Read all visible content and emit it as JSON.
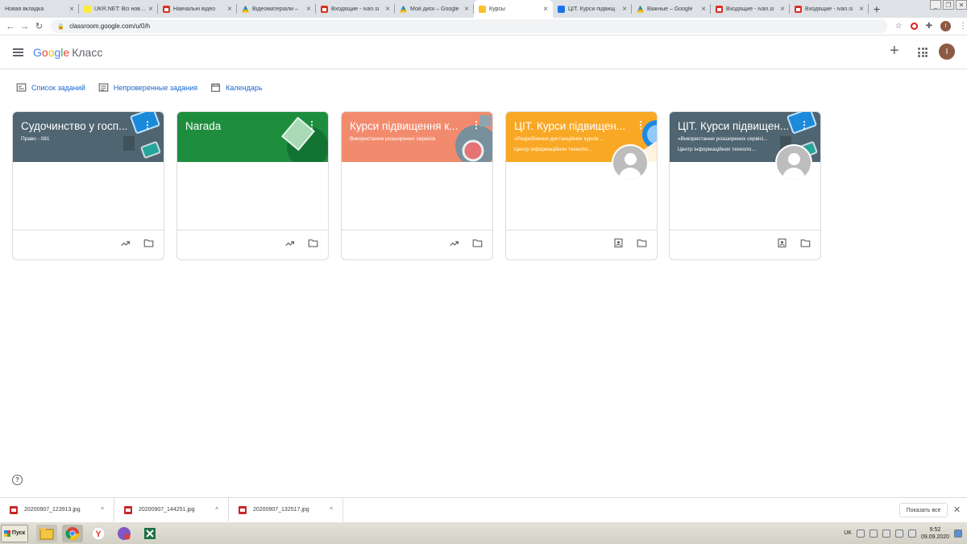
{
  "browser": {
    "tabs": [
      {
        "title": "Новая вкладка",
        "fav": "#ffffff",
        "active": false
      },
      {
        "title": "UKR.NET: Всі новини",
        "fav": "#ffeb3b",
        "active": false
      },
      {
        "title": "Навчальні відео",
        "fav": "gmail",
        "active": false
      },
      {
        "title": "Відеоматеріали –",
        "fav": "drive",
        "active": false
      },
      {
        "title": "Входящие - ivan.si",
        "fav": "gmail",
        "active": false
      },
      {
        "title": "Мой диск – Google",
        "fav": "drive",
        "active": false
      },
      {
        "title": "Курсы",
        "fav": "#fbc02d",
        "active": true
      },
      {
        "title": "ЦІТ. Курси підвищ",
        "fav": "#1a73e8",
        "active": false
      },
      {
        "title": "Важные – Google",
        "fav": "drive",
        "active": false
      },
      {
        "title": "Входящие - ivan.si",
        "fav": "gmail",
        "active": false
      },
      {
        "title": "Входящие - ivan.si",
        "fav": "gmail",
        "active": false
      }
    ],
    "url": "classroom.google.com/u/0/h",
    "profile_initial": "I"
  },
  "app": {
    "logo_google": "Google",
    "logo_product": "Класс",
    "user_initial": "I"
  },
  "subnav": {
    "tasks": "Список заданий",
    "unchecked": "Непроверенные задания",
    "calendar": "Календарь"
  },
  "courses": [
    {
      "title": "Судочинство у госп...",
      "subtitle": "Право - 081",
      "subtitle2": "",
      "color": "#4f6571",
      "theme": "tech",
      "footer": "trend",
      "teacher_avatar": false
    },
    {
      "title": "Narada",
      "subtitle": "",
      "subtitle2": "",
      "color": "#1e8e3e",
      "theme": "book",
      "footer": "trend",
      "teacher_avatar": false
    },
    {
      "title": "Курси підвищення к...",
      "subtitle": "Використання розширених сервісів",
      "subtitle2": "",
      "color": "#f28b6e",
      "theme": "sci",
      "footer": "trend",
      "teacher_avatar": false
    },
    {
      "title": "ЦІТ. Курси підвищен...",
      "subtitle": "«Розроблення дистанційних курсів ...",
      "subtitle2": "Центр інформаційних техноло...",
      "color": "#f9a825",
      "theme": "orange",
      "footer": "portfolio",
      "teacher_avatar": true
    },
    {
      "title": "ЦІТ. Курси підвищен...",
      "subtitle": "«Використання розширених сервісі...",
      "subtitle2": "Центр інформаційних техноло...",
      "color": "#4f6571",
      "theme": "tech",
      "footer": "portfolio",
      "teacher_avatar": true
    }
  ],
  "downloads": [
    {
      "name": "20200907_123913.jpg"
    },
    {
      "name": "20200907_144251.jpg"
    },
    {
      "name": "20200907_132517.jpg"
    }
  ],
  "shelf": {
    "show_all": "Показать все"
  },
  "help_icon": "?",
  "taskbar": {
    "start_label": "Пуск",
    "lang": "UK",
    "time": "9:52",
    "date": "09.09.2020"
  }
}
